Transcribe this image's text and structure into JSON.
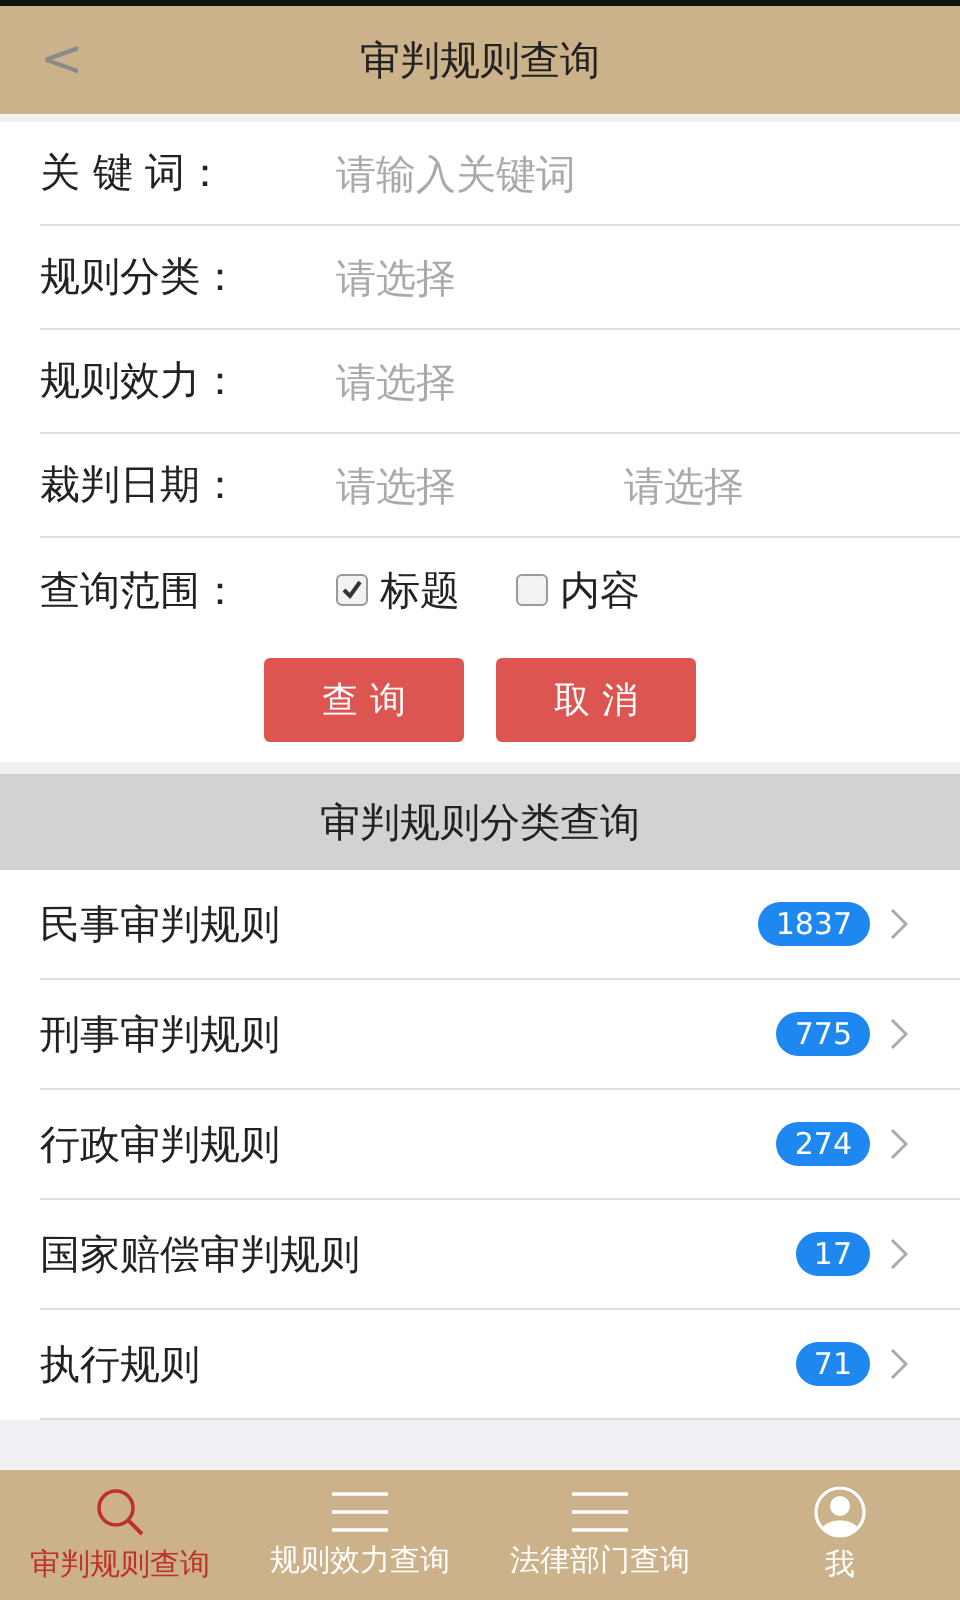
{
  "header": {
    "back": "<",
    "title": "审判规则查询"
  },
  "form": {
    "fields": [
      {
        "kind": "input",
        "label": "关 键 词：",
        "placeholder": "请输入关键词"
      },
      {
        "kind": "select",
        "label": "规则分类：",
        "placeholder": "请选择"
      },
      {
        "kind": "select",
        "label": "规则效力：",
        "placeholder": "请选择"
      },
      {
        "kind": "range",
        "label": "裁判日期：",
        "placeholders": [
          "请选择",
          "请选择"
        ]
      }
    ],
    "scope": {
      "label": "查询范围：",
      "options": [
        {
          "label": "标题",
          "checked": true
        },
        {
          "label": "内容",
          "checked": false
        }
      ]
    },
    "buttons": [
      "查 询",
      "取 消"
    ]
  },
  "categories": {
    "title": "审判规则分类查询",
    "items": [
      {
        "name": "民事审判规则",
        "count": "1837"
      },
      {
        "name": "刑事审判规则",
        "count": "775"
      },
      {
        "name": "行政审判规则",
        "count": "274"
      },
      {
        "name": "国家赔偿审判规则",
        "count": "17"
      },
      {
        "name": "执行规则",
        "count": "71"
      }
    ]
  },
  "tabs": [
    {
      "kind": "search",
      "label": "审判规则查询",
      "selected": true
    },
    {
      "kind": "menu",
      "label": "规则效力查询",
      "selected": false
    },
    {
      "kind": "menu",
      "label": "法律部门查询",
      "selected": false
    },
    {
      "kind": "user",
      "label": "我",
      "selected": false
    }
  ]
}
